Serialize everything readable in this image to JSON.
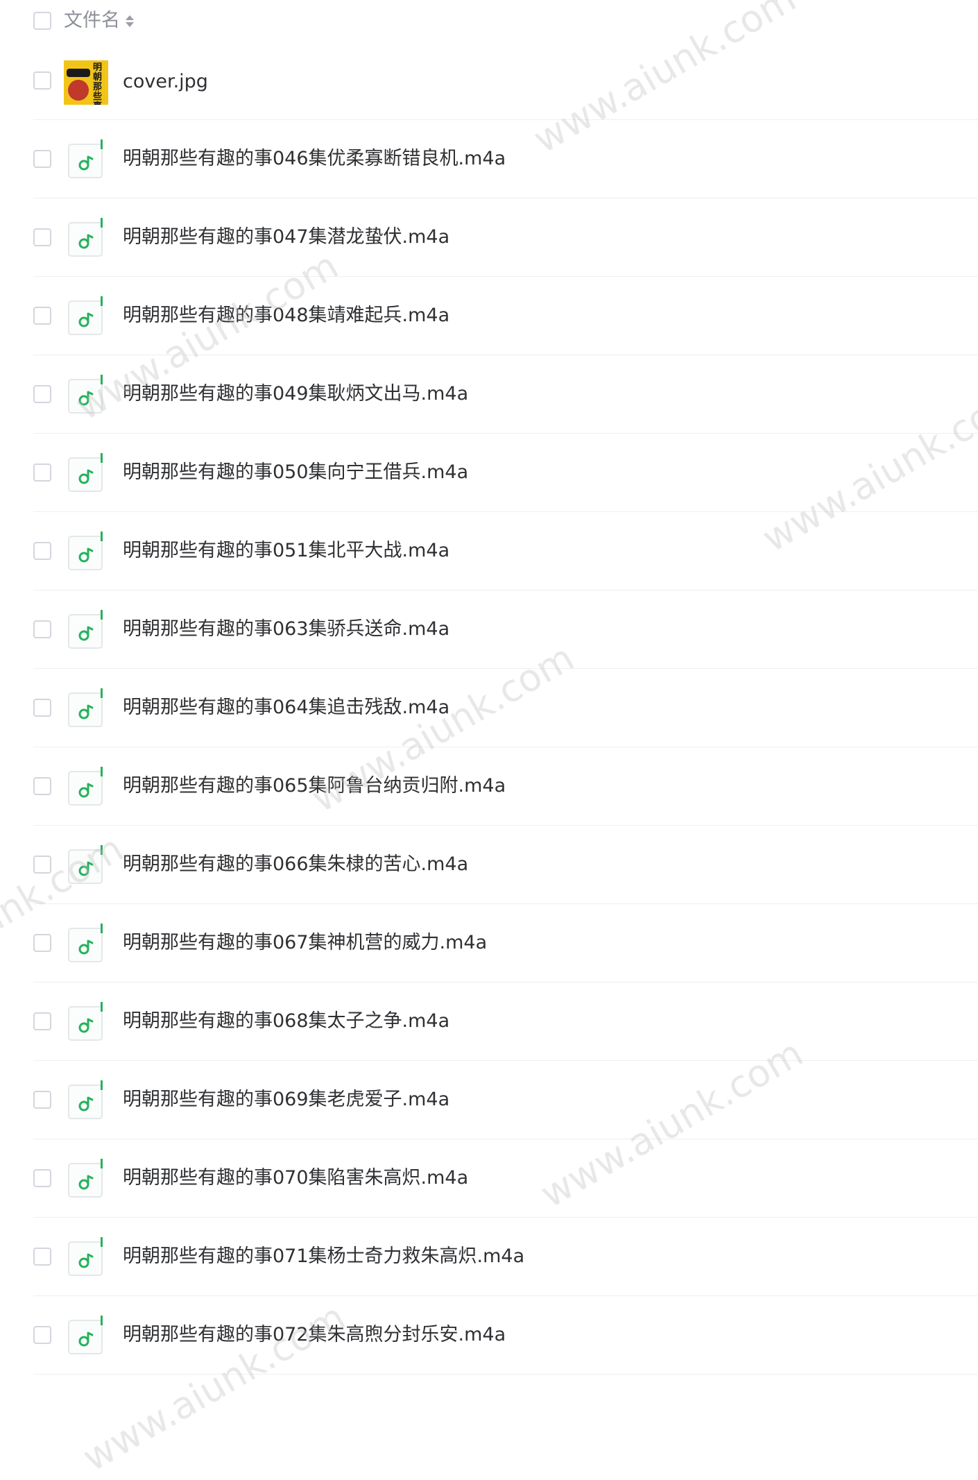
{
  "header": {
    "column_label": "文件名"
  },
  "files": [
    {
      "name": "cover.jpg",
      "type": "image"
    },
    {
      "name": "明朝那些有趣的事046集优柔寡断错良机.m4a",
      "type": "audio"
    },
    {
      "name": "明朝那些有趣的事047集潜龙蛰伏.m4a",
      "type": "audio"
    },
    {
      "name": "明朝那些有趣的事048集靖难起兵.m4a",
      "type": "audio"
    },
    {
      "name": "明朝那些有趣的事049集耿炳文出马.m4a",
      "type": "audio"
    },
    {
      "name": "明朝那些有趣的事050集向宁王借兵.m4a",
      "type": "audio"
    },
    {
      "name": "明朝那些有趣的事051集北平大战.m4a",
      "type": "audio"
    },
    {
      "name": "明朝那些有趣的事063集骄兵送命.m4a",
      "type": "audio"
    },
    {
      "name": "明朝那些有趣的事064集追击残敌.m4a",
      "type": "audio"
    },
    {
      "name": "明朝那些有趣的事065集阿鲁台纳贡归附.m4a",
      "type": "audio"
    },
    {
      "name": "明朝那些有趣的事066集朱棣的苦心.m4a",
      "type": "audio"
    },
    {
      "name": "明朝那些有趣的事067集神机营的威力.m4a",
      "type": "audio"
    },
    {
      "name": "明朝那些有趣的事068集太子之争.m4a",
      "type": "audio"
    },
    {
      "name": "明朝那些有趣的事069集老虎爱子.m4a",
      "type": "audio"
    },
    {
      "name": "明朝那些有趣的事070集陷害朱高炽.m4a",
      "type": "audio"
    },
    {
      "name": "明朝那些有趣的事071集杨士奇力救朱高炽.m4a",
      "type": "audio"
    },
    {
      "name": "明朝那些有趣的事072集朱高煦分封乐安.m4a",
      "type": "audio"
    }
  ],
  "thumbnail": {
    "cover_text": "明朝那些事"
  },
  "watermark": {
    "text": "www.aiunk.com"
  },
  "colors": {
    "audio_accent": "#27b15d",
    "cover_bg": "#f2c418",
    "row_divider": "#eeeff1",
    "header_text": "#8b8f97"
  },
  "icons": {
    "audio_file": "music-note-icon",
    "sort": "sort-icon",
    "image_file": "image-thumbnail"
  }
}
